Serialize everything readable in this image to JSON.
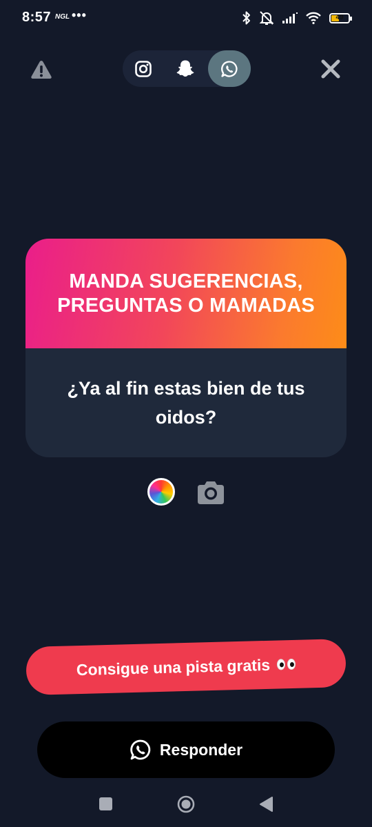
{
  "status_bar": {
    "time": "8:57",
    "app_indicator": "NGL",
    "overflow_dots": "•••",
    "battery_level": "49",
    "icons": [
      "bluetooth-icon",
      "mute-icon",
      "signal-icon",
      "wifi-icon",
      "battery-icon"
    ]
  },
  "toolbar": {
    "left_icon": "warning-icon",
    "right_icon": "close-icon",
    "share_targets": [
      "instagram-icon",
      "snapchat-icon",
      "whatsapp-icon"
    ],
    "selected_share": "whatsapp"
  },
  "card": {
    "title": "MANDA SUGERENCIAS,\nPREGUNTAS O MAMADAS",
    "question": "¿Ya al fin estas bien de tus oidos?"
  },
  "tools": {
    "color_icon": "color-wheel-icon",
    "camera_icon": "camera-icon"
  },
  "hint_button": {
    "label": "Consigue una pista gratis",
    "emoji_icon": "eyes-icon"
  },
  "reply_button": {
    "label": "Responder",
    "icon": "whatsapp-icon"
  },
  "nav_bar": {
    "buttons": [
      "recents-icon",
      "home-icon",
      "back-icon"
    ]
  },
  "colors": {
    "background": "#131929",
    "card_body": "#1f293b",
    "gradient_start": "#ea1e8a",
    "gradient_end": "#fd8c18",
    "hint_button": "#ef3b4e",
    "reply_button": "#000000",
    "whatsapp_selected": "#5c7680"
  }
}
